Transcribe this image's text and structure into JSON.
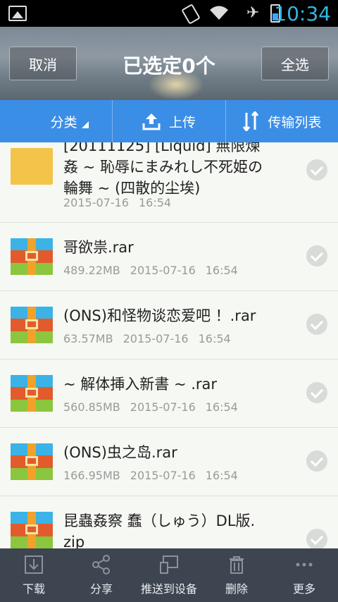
{
  "status_bar": {
    "time": "10:34",
    "icons": [
      "image-icon",
      "screen-rotation-icon",
      "wifi-icon",
      "airplane-icon",
      "battery-icon"
    ]
  },
  "header": {
    "cancel_label": "取消",
    "title": "已选定0个",
    "select_all_label": "全选"
  },
  "tabs": [
    {
      "label": "分类",
      "icon": "grid-icon"
    },
    {
      "label": "上传",
      "icon": "upload-icon"
    },
    {
      "label": "传输列表",
      "icon": "transfer-icon"
    }
  ],
  "files": [
    {
      "type": "folder",
      "name_line1": "[20111125] [Liquid] 無限煉",
      "name_line2": "姦 ~ 恥辱にまみれし不死姫の",
      "name_line3": "輪舞 ~ (四散的尘埃)",
      "size": "",
      "date": "2015-07-16",
      "time": "16:54"
    },
    {
      "type": "rar",
      "name": "哥欲祟.rar",
      "size": "489.22MB",
      "date": "2015-07-16",
      "time": "16:54"
    },
    {
      "type": "rar",
      "name": "(ONS)和怪物谈恋爱吧 ！.rar",
      "size": "63.57MB",
      "date": "2015-07-16",
      "time": "16:54"
    },
    {
      "type": "rar",
      "name": " ~ 解体挿入新書 ~ .rar",
      "size": "560.85MB",
      "date": "2015-07-16",
      "time": "16:54"
    },
    {
      "type": "rar",
      "name": "(ONS)虫之岛.rar",
      "size": "166.95MB",
      "date": "2015-07-16",
      "time": "16:54"
    },
    {
      "type": "rar",
      "name_line1": "昆蟲姦察 蠢（しゅう）DL版.",
      "name_line2": "zip"
    }
  ],
  "bottom_bar": [
    {
      "label": "下载",
      "icon": "download-icon"
    },
    {
      "label": "分享",
      "icon": "share-icon"
    },
    {
      "label": "推送到设备",
      "icon": "push-device-icon"
    },
    {
      "label": "删除",
      "icon": "trash-icon"
    },
    {
      "label": "更多",
      "icon": "more-icon"
    }
  ],
  "colors": {
    "tab_bar": "#3a8ee6",
    "bottom_bar": "#3d4550",
    "list_bg": "#f6f8f3",
    "clock": "#33b5e5"
  }
}
